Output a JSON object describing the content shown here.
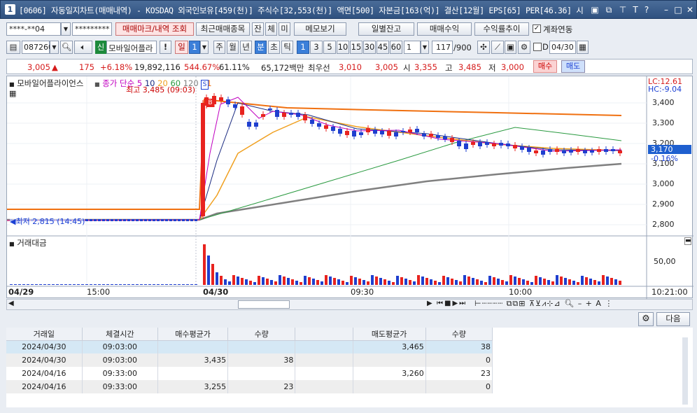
{
  "titlebar": {
    "num": "1",
    "title": "[0606] 자동일지차트(매매내역) - KOSDAQ 외국인보유[459(천)] 주식수[32,553(천)] 액면[500] 자본금[163(억)] 결산[12월] EPS[65] PER[46.36] 시"
  },
  "toolbar1": {
    "account": "****-**04",
    "password": "*********",
    "btn_mark": "매매마크/내역 조회",
    "btn_recent": "최근매매종목",
    "btn_jan": "잔",
    "btn_che": "체",
    "btn_mi": "미",
    "btn_memo": "메모보기",
    "btn_daily": "일별잔고",
    "btn_profit": "매매수익",
    "btn_trend": "수익률추이",
    "link_label": "계좌연동"
  },
  "toolbar2": {
    "code": "087260",
    "badge": "신",
    "stock_name": "모바일어플라",
    "exclaim": "!",
    "day": "일",
    "day_n": "1",
    "week": "주",
    "month": "월",
    "year": "년",
    "minute": "분",
    "sec": "초",
    "tick": "틱",
    "periods": [
      "1",
      "3",
      "5",
      "10",
      "15",
      "30",
      "45",
      "60"
    ],
    "count": "1",
    "range": "117",
    "range_total": "/900",
    "d_label": "D",
    "date": "04/30"
  },
  "pricebar": {
    "price": "3,005",
    "arrow": "▲",
    "change": "175",
    "pct": "+6.18%",
    "volume": "19,892,116",
    "vol_ratio": "544.67%",
    "turn": "61.11%",
    "amount": "65,172백만",
    "best_label": "최우선",
    "ask": "3,010",
    "bid": "3,005",
    "open_label": "시",
    "open": "3,355",
    "high_label": "고",
    "high": "3,485",
    "low_label": "저",
    "low": "3,000",
    "buy": "매수",
    "sell": "매도"
  },
  "chart": {
    "title": "모바일어플라이언스",
    "legend": "종가 단순",
    "ma": [
      "5",
      "10",
      "20",
      "60",
      "120"
    ],
    "v1": "V1",
    "lc": "LC:12.61",
    "hc": "HC:-9.04",
    "high_note": "최고 3,485 (09:03)",
    "low_note": "최저 2,815 (14:45)",
    "y_ticks": [
      "3,400",
      "3,300",
      "3,200",
      "3,100",
      "3,000",
      "2,900",
      "2,800"
    ],
    "cur_price": "3,170",
    "cur_pct": "-0.16%",
    "vol_title": "거래대금",
    "vol_tick": "50,00",
    "x_labels": [
      "04/29",
      "15:00",
      "04/30",
      "09:30",
      "10:00"
    ],
    "time": "10:21:00",
    "marker_s": "S",
    "marker_b": "B",
    "colors": {
      "up": "#e8231f",
      "down": "#1f3fcf",
      "ma5": "#c000c0",
      "ma10": "#1a2a80",
      "ma20": "#f0a020",
      "ma60": "#2a9a40",
      "ma120": "#808080",
      "line_orange": "#f07010"
    }
  },
  "bottom": {
    "next": "다음"
  },
  "table": {
    "headers": [
      "거래일",
      "체결시간",
      "매수평균가",
      "수량",
      "",
      "매도평균가",
      "수량"
    ],
    "rows": [
      [
        "2024/04/30",
        "09:03:00",
        "",
        "",
        "",
        "3,465",
        "38"
      ],
      [
        "2024/04/30",
        "09:03:00",
        "3,435",
        "38",
        "",
        "",
        "0"
      ],
      [
        "2024/04/16",
        "09:33:00",
        "",
        "",
        "",
        "3,260",
        "23"
      ],
      [
        "2024/04/16",
        "09:33:00",
        "3,255",
        "23",
        "",
        "",
        "0"
      ]
    ]
  }
}
